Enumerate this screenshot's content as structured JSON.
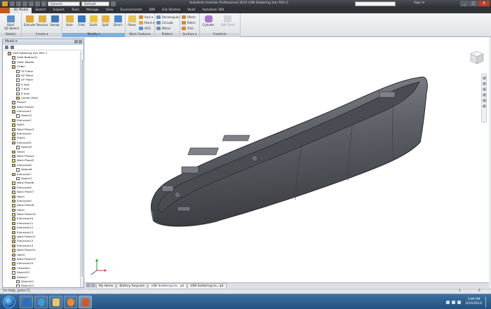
{
  "window": {
    "title": "Autodesk Inventor Professional 2015    USB Soldering Iron REV 2",
    "appearance_combo": "Generic",
    "material_combo": "Default",
    "signin": "Sign In",
    "winbtns": [
      "_",
      "□",
      "X"
    ]
  },
  "ribbon_tabs": [
    "3D Model",
    "Sketch",
    "Inspect",
    "Tools",
    "Manage",
    "View",
    "Environments",
    "BIM",
    "Get Started",
    "Vault",
    "Autodesk 360"
  ],
  "ribbon": {
    "sketch": {
      "start": "Start",
      "sketch2d": "2D Sketch",
      "group": "Sketch"
    },
    "create": {
      "extrude": "Extrude",
      "revolve": "Revolve",
      "sweep": "Sweep",
      "group": "Create ▾"
    },
    "modify": {
      "hole": "Hole",
      "fillet": "Fillet",
      "draft": "Draft",
      "split": "Split",
      "direct": "Direct",
      "group": "Modify ▾"
    },
    "work": {
      "plane": "Plane",
      "axis": "Axis ▾",
      "point": "Point ▾",
      "ucs": "UCS",
      "group": "Work Features"
    },
    "pattern": {
      "rect": "Rectangular",
      "circular": "Circular",
      "mirror": "Mirror",
      "group": "Pattern"
    },
    "surface": {
      "stitch": "Stitch",
      "patch": "Patch",
      "trim": "Trim",
      "group": "Surface ▾"
    },
    "freeform": {
      "cylinder": "Cylinder",
      "edit": "Edit Form",
      "group": "Freeform"
    }
  },
  "panel": {
    "title": "Model ▾",
    "tree": [
      {
        "label": "USB Soldering Iron REV 2",
        "indent": 0,
        "color": "#e6c24a"
      },
      {
        "label": "Solid Bodies(2)",
        "indent": 1,
        "color": "#d9d9d9"
      },
      {
        "label": "View: Master",
        "indent": 1,
        "color": "#d9d9d9"
      },
      {
        "label": "Origin",
        "indent": 1,
        "color": "#e6c24a"
      },
      {
        "label": "YZ Plane",
        "indent": 2,
        "color": "#ffffff"
      },
      {
        "label": "XZ Plane",
        "indent": 2,
        "color": "#ffffff"
      },
      {
        "label": "XY Plane",
        "indent": 2,
        "color": "#ffffff"
      },
      {
        "label": "X Axis",
        "indent": 2,
        "color": "#ffffff"
      },
      {
        "label": "Y Axis",
        "indent": 2,
        "color": "#ffffff"
      },
      {
        "label": "Z Axis",
        "indent": 2,
        "color": "#ffffff"
      },
      {
        "label": "Center Point",
        "indent": 2,
        "color": "#f0c040"
      },
      {
        "label": "Plane3",
        "indent": 1,
        "color": "#b6e0a0"
      },
      {
        "label": "Work Plane2",
        "indent": 1,
        "color": "#f4d76a"
      },
      {
        "label": "Extrusion1",
        "indent": 1,
        "color": "#e6c24a"
      },
      {
        "label": "Sketch1",
        "indent": 2,
        "color": "#ffffff"
      },
      {
        "label": "Extrusion2",
        "indent": 1,
        "color": "#e6c24a"
      },
      {
        "label": "Split1",
        "indent": 1,
        "color": "#e6c24a"
      },
      {
        "label": "Work Plane3",
        "indent": 1,
        "color": "#f4d76a"
      },
      {
        "label": "Extrusion4",
        "indent": 1,
        "color": "#e6c24a"
      },
      {
        "label": "Shell1",
        "indent": 1,
        "color": "#e6c24a"
      },
      {
        "label": "Extrusion5",
        "indent": 1,
        "color": "#e6c24a"
      },
      {
        "label": "Sketch5",
        "indent": 2,
        "color": "#ffffff"
      },
      {
        "label": "Fillet1",
        "indent": 1,
        "color": "#e6c24a"
      },
      {
        "label": "Work Plane4",
        "indent": 1,
        "color": "#f4d76a"
      },
      {
        "label": "Work Plane5",
        "indent": 1,
        "color": "#f4d76a"
      },
      {
        "label": "Extrusion6",
        "indent": 1,
        "color": "#e6c24a"
      },
      {
        "label": "Sketch6",
        "indent": 2,
        "color": "#ffffff"
      },
      {
        "label": "Extrusion7",
        "indent": 1,
        "color": "#e6c24a"
      },
      {
        "label": "Sketch7",
        "indent": 2,
        "color": "#ffffff"
      },
      {
        "label": "Work Plane6",
        "indent": 1,
        "color": "#f4d76a"
      },
      {
        "label": "Extrusion8",
        "indent": 1,
        "color": "#e6c24a"
      },
      {
        "label": "Work Plane7",
        "indent": 1,
        "color": "#f4d76a"
      },
      {
        "label": "Hole1",
        "indent": 1,
        "color": "#e6c24a"
      },
      {
        "label": "Extrusion9",
        "indent": 1,
        "color": "#e6c24a"
      },
      {
        "label": "Work Plane8",
        "indent": 1,
        "color": "#f4d76a"
      },
      {
        "label": "Hole2",
        "indent": 1,
        "color": "#e6c24a"
      },
      {
        "label": "Work Plane10",
        "indent": 1,
        "color": "#f4d76a"
      },
      {
        "label": "Extrusion10",
        "indent": 1,
        "color": "#e6c24a"
      },
      {
        "label": "Extrusion11",
        "indent": 1,
        "color": "#e6c24a"
      },
      {
        "label": "Extrusion12",
        "indent": 1,
        "color": "#e6c24a"
      },
      {
        "label": "Extrusion13",
        "indent": 1,
        "color": "#e6c24a"
      },
      {
        "label": "Work Plane11",
        "indent": 1,
        "color": "#f4d76a"
      },
      {
        "label": "Extrusion13",
        "indent": 1,
        "color": "#e6c24a"
      },
      {
        "label": "Extrusion14",
        "indent": 1,
        "color": "#e6c24a"
      },
      {
        "label": "Work Plane12",
        "indent": 1,
        "color": "#f4d76a"
      },
      {
        "label": "Hole3",
        "indent": 1,
        "color": "#e6c24a"
      },
      {
        "label": "Work Plane13",
        "indent": 1,
        "color": "#f4d76a"
      },
      {
        "label": "Extrusion15",
        "indent": 1,
        "color": "#e6c24a"
      },
      {
        "label": "Chamfer1",
        "indent": 1,
        "color": "#e6c24a"
      },
      {
        "label": "Sketch22",
        "indent": 1,
        "color": "#ffffff"
      },
      {
        "label": "Sweep1",
        "indent": 1,
        "color": "#e6c24a"
      },
      {
        "label": "Sketch22",
        "indent": 2,
        "color": "#ffffff"
      },
      {
        "label": "Sketch23",
        "indent": 2,
        "color": "#ffffff"
      }
    ]
  },
  "doc_tabs": [
    "My Home",
    "Battery Assy.iam",
    "USB Soldering Iro...ipt",
    "USB Soldering Iro...ipt"
  ],
  "status": {
    "help": "For Help, press F1",
    "count1": "1",
    "count2": "5"
  },
  "taskbar": {
    "time": "3:09 PM",
    "date": "6/16/2014"
  }
}
